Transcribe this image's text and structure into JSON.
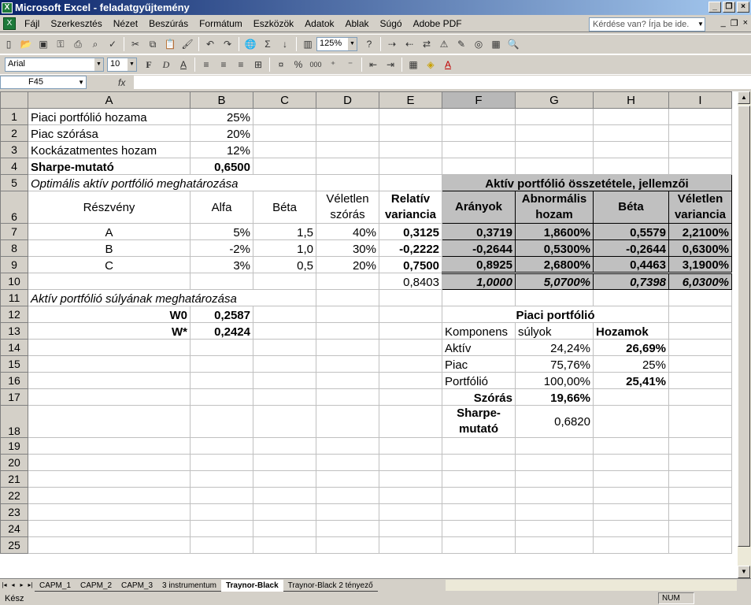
{
  "window": {
    "title": "Microsoft Excel - feladatgyűjtemény"
  },
  "menu": [
    "Fájl",
    "Szerkesztés",
    "Nézet",
    "Beszúrás",
    "Formátum",
    "Eszközök",
    "Adatok",
    "Ablak",
    "Súgó",
    "Adobe PDF"
  ],
  "help_placeholder": "Kérdése van? Írja be ide.",
  "toolbar": {
    "zoom": "125%",
    "font": "Arial",
    "size": "10"
  },
  "formula": {
    "namebox": "F45",
    "fx": "fx",
    "value": ""
  },
  "columns": [
    "A",
    "B",
    "C",
    "D",
    "E",
    "F",
    "G",
    "H",
    "I"
  ],
  "cells": {
    "r1": {
      "a": "Piaci portfólió hozama",
      "b": "25%"
    },
    "r2": {
      "a": "Piac szórása",
      "b": "20%"
    },
    "r3": {
      "a": "Kockázatmentes hozam",
      "b": "12%"
    },
    "r4": {
      "a": "Sharpe-mutató",
      "b": "0,6500"
    },
    "r5": {
      "a": "Optimális aktív portfólió meghatározása",
      "f": "Aktív portfólió összetétele, jellemzői"
    },
    "r6": {
      "a": "Részvény",
      "b": "Alfa",
      "c": "Béta",
      "d": "Véletlen szórás",
      "e": "Relatív variancia",
      "f": "Arányok",
      "g": "Abnormális hozam",
      "h": "Béta",
      "i": "Véletlen variancia"
    },
    "r7": {
      "a": "A",
      "b": "5%",
      "c": "1,5",
      "d": "40%",
      "e": "0,3125",
      "f": "0,3719",
      "g": "1,8600%",
      "h": "0,5579",
      "i": "2,2100%"
    },
    "r8": {
      "a": "B",
      "b": "-2%",
      "c": "1,0",
      "d": "30%",
      "e": "-0,2222",
      "f": "-0,2644",
      "g": "0,5300%",
      "h": "-0,2644",
      "i": "0,6300%"
    },
    "r9": {
      "a": "C",
      "b": "3%",
      "c": "0,5",
      "d": "20%",
      "e": "0,7500",
      "f": "0,8925",
      "g": "2,6800%",
      "h": "0,4463",
      "i": "3,1900%"
    },
    "r10": {
      "e": "0,8403",
      "f": "1,0000",
      "g": "5,0700%",
      "h": "0,7398",
      "i": "6,0300%"
    },
    "r11": {
      "a": "Aktív portfólió súlyának meghatározása"
    },
    "r12": {
      "a": "W0",
      "b": "0,2587",
      "fg": "Piaci portfólió"
    },
    "r13": {
      "a": "W*",
      "b": "0,2424",
      "f": "Komponens",
      "g": "súlyok",
      "h": "Hozamok"
    },
    "r14": {
      "f": "Aktív",
      "g": "24,24%",
      "h": "26,69%"
    },
    "r15": {
      "f": "Piac",
      "g": "75,76%",
      "h": "25%"
    },
    "r16": {
      "f": "Portfólió",
      "g": "100,00%",
      "h": "25,41%"
    },
    "r17": {
      "f": "Szórás",
      "g": "19,66%"
    },
    "r18": {
      "f": "Sharpe-mutató",
      "g": "0,6820"
    }
  },
  "rows": [
    "1",
    "2",
    "3",
    "4",
    "5",
    "6",
    "7",
    "8",
    "9",
    "10",
    "11",
    "12",
    "13",
    "14",
    "15",
    "16",
    "17",
    "18",
    "19",
    "20",
    "21",
    "22",
    "23",
    "24",
    "25"
  ],
  "sheets": [
    "CAPM_1",
    "CAPM_2",
    "CAPM_3",
    "3 instrumentum",
    "Traynor-Black",
    "Traynor-Black 2 tényező"
  ],
  "status": {
    "left": "Kész",
    "num": "NUM"
  }
}
